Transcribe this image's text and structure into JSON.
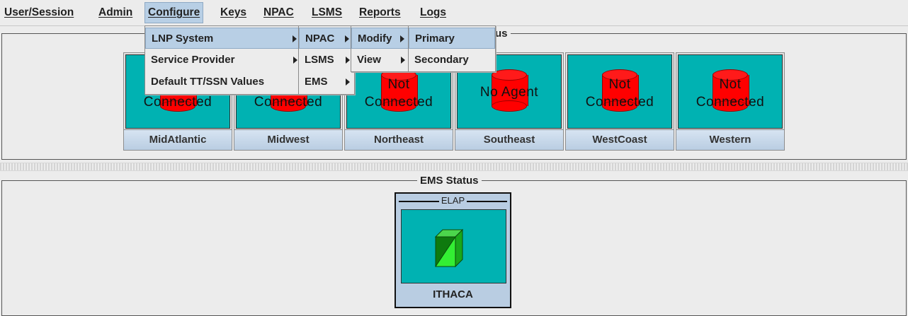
{
  "menubar": {
    "items": [
      "User/Session",
      "Admin",
      "Configure",
      "Keys",
      "NPAC",
      "LSMS",
      "Reports",
      "Logs"
    ]
  },
  "menus": {
    "configure": [
      {
        "label": "LNP System",
        "has_submenu": true,
        "highlighted": true
      },
      {
        "label": "Service Provider",
        "has_submenu": true
      },
      {
        "label": "Default TT/SSN Values",
        "has_submenu": false
      }
    ],
    "lnp_system": [
      {
        "label": "NPAC",
        "has_submenu": true,
        "highlighted": true
      },
      {
        "label": "LSMS",
        "has_submenu": true
      },
      {
        "label": "EMS",
        "has_submenu": true
      }
    ],
    "npac": [
      {
        "label": "Modify",
        "has_submenu": true,
        "highlighted": true
      },
      {
        "label": "View",
        "has_submenu": true
      }
    ],
    "modify": [
      {
        "label": "Primary",
        "highlighted": true
      },
      {
        "label": "Secondary"
      }
    ]
  },
  "npac_panel": {
    "title_visible": "us",
    "regions": [
      {
        "name": "MidAtlantic",
        "status": "Connected"
      },
      {
        "name": "Midwest",
        "status": "Connected"
      },
      {
        "name": "Northeast",
        "status_line1": "Not",
        "status_line2": "Connected"
      },
      {
        "name": "Southeast",
        "status": "No Agent"
      },
      {
        "name": "WestCoast",
        "status_line1": "Not",
        "status_line2": "Connected"
      },
      {
        "name": "Western",
        "status_line1": "Not",
        "status_line2": "Connected"
      }
    ]
  },
  "ems_panel": {
    "title": "EMS Status",
    "tile": {
      "tag": "ELAP",
      "name": "ITHACA"
    }
  },
  "colors": {
    "tile_background": "#00b2b2",
    "db_down": "#ff0000",
    "ems_ok": "#22dd22",
    "menu_highlight": "#b8cfe5"
  }
}
